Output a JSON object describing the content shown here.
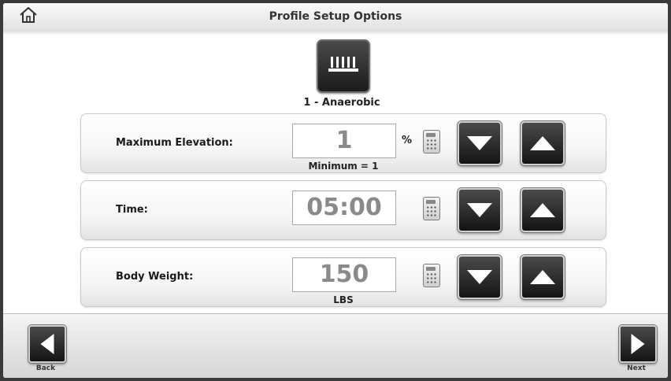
{
  "header": {
    "title": "Profile Setup Options",
    "home_icon": "home-icon"
  },
  "profile": {
    "icon": "bar-profile-icon",
    "name": "1 - Anaerobic"
  },
  "options": [
    {
      "label": "Maximum Elevation:",
      "value": "1",
      "unit": "%",
      "sub_label": "Minimum = 1"
    },
    {
      "label": "Time:",
      "value": "05:00",
      "unit": "",
      "sub_label": ""
    },
    {
      "label": "Body Weight:",
      "value": "150",
      "unit": "",
      "sub_label": "LBS"
    }
  ],
  "icons": {
    "calculator": "calculator-icon",
    "decrease": "down-arrow-icon",
    "increase": "up-arrow-icon",
    "back": "left-arrow-icon",
    "next": "right-arrow-icon"
  },
  "footer": {
    "back_label": "Back",
    "next_label": "Next"
  }
}
